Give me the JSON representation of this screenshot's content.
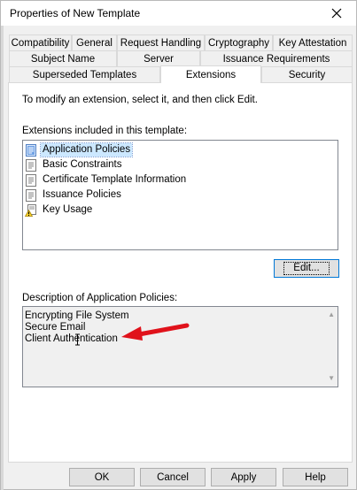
{
  "window": {
    "title": "Properties of New Template"
  },
  "tabs": {
    "row1": [
      "Compatibility",
      "General",
      "Request Handling",
      "Cryptography",
      "Key Attestation"
    ],
    "row2": [
      "Subject Name",
      "Server",
      "Issuance Requirements"
    ],
    "row3": [
      "Superseded Templates",
      "Extensions",
      "Security"
    ],
    "active": "Extensions"
  },
  "panel": {
    "instruction": "To modify an extension, select it, and then click Edit.",
    "extensions_label": "Extensions included in this template:",
    "extensions": [
      {
        "label": "Application Policies",
        "icon": "policy-icon",
        "selected": true
      },
      {
        "label": "Basic Constraints",
        "icon": "document-icon",
        "selected": false
      },
      {
        "label": "Certificate Template Information",
        "icon": "document-icon",
        "selected": false
      },
      {
        "label": "Issuance Policies",
        "icon": "document-icon",
        "selected": false
      },
      {
        "label": "Key Usage",
        "icon": "warning-document-icon",
        "selected": false
      }
    ],
    "edit_button": "Edit...",
    "description_label": "Description of Application Policies:",
    "description_lines": [
      "Encrypting File System",
      "Secure Email",
      "Client Authentication"
    ]
  },
  "footer": {
    "ok": "OK",
    "cancel": "Cancel",
    "apply": "Apply",
    "help": "Help"
  },
  "colors": {
    "selection": "#cce8ff",
    "accent_border": "#0078d7",
    "annotation_arrow": "#e0121b"
  }
}
